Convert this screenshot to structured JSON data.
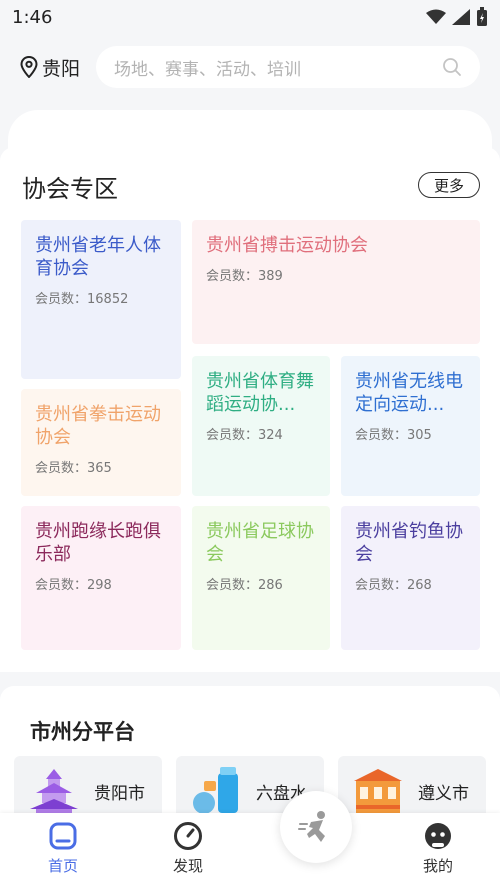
{
  "status": {
    "time": "1:46"
  },
  "header": {
    "city": "贵阳",
    "search_placeholder": "场地、赛事、活动、培训"
  },
  "associations": {
    "title": "协会专区",
    "more_label": "更多",
    "items": [
      {
        "name": "贵州省老年人体育协会",
        "count_text": "会员数：16852",
        "color": "#3b5bc9",
        "bg": "#eef1fb"
      },
      {
        "name": "贵州省搏击运动协会",
        "count_text": "会员数：389",
        "color": "#e06f7c",
        "bg": "#fdf1f2"
      },
      {
        "name": "贵州省体育舞蹈运动协...",
        "count_text": "会员数：324",
        "color": "#2fae83",
        "bg": "#effaf5"
      },
      {
        "name": "贵州省无线电定向运动...",
        "count_text": "会员数：305",
        "color": "#2f6fd1",
        "bg": "#eef5fc"
      },
      {
        "name": "贵州省拳击运动协会",
        "count_text": "会员数：365",
        "color": "#f0a36a",
        "bg": "#fef6ef"
      },
      {
        "name": "贵州跑缘长跑俱乐部",
        "count_text": "会员数：298",
        "color": "#8c2a5c",
        "bg": "#fdf0f6"
      },
      {
        "name": "贵州省足球协会",
        "count_text": "会员数：286",
        "color": "#8bc95e",
        "bg": "#f3fbee"
      },
      {
        "name": "贵州省钓鱼协会",
        "count_text": "会员数：268",
        "color": "#4b3f9f",
        "bg": "#f3f1fb"
      }
    ]
  },
  "cities": {
    "title": "市州分平台",
    "items": [
      {
        "name": "贵阳市",
        "icon": "pagoda-icon"
      },
      {
        "name": "六盘水",
        "icon": "cans-icon"
      },
      {
        "name": "遵义市",
        "icon": "building-icon"
      }
    ]
  },
  "tabbar": {
    "tabs": [
      {
        "label": "首页",
        "active": true
      },
      {
        "label": "发现",
        "active": false
      },
      {
        "label": "我的",
        "active": false
      }
    ],
    "accent": "#4a6de5"
  }
}
